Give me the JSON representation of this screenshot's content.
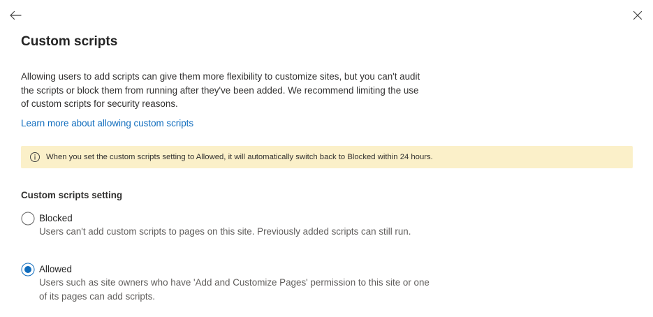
{
  "panel": {
    "title": "Custom scripts",
    "description": "Allowing users to add scripts can give them more flexibility to customize sites, but you can't audit the scripts or block them from running after they've been added. We recommend limiting the use of custom scripts for security reasons.",
    "learn_more_link": "Learn more about allowing custom scripts",
    "banner_text": "When you set the custom scripts setting to Allowed, it will automatically switch back to Blocked within 24 hours."
  },
  "setting": {
    "label": "Custom scripts setting",
    "selected": "allowed",
    "options": [
      {
        "id": "blocked",
        "label": "Blocked",
        "description": "Users can't add custom scripts to pages on this site. Previously added scripts can still run."
      },
      {
        "id": "allowed",
        "label": "Allowed",
        "description": "Users such as site owners who have 'Add and Customize Pages' permission to this site or one of its pages can add scripts."
      }
    ]
  },
  "colors": {
    "accent": "#0f6cbd",
    "banner_bg": "#fbf0c9",
    "text": "#242424",
    "secondary_text": "#605e5c"
  },
  "icons": {
    "back": "arrow-left-icon",
    "close": "close-icon",
    "info": "info-icon"
  }
}
